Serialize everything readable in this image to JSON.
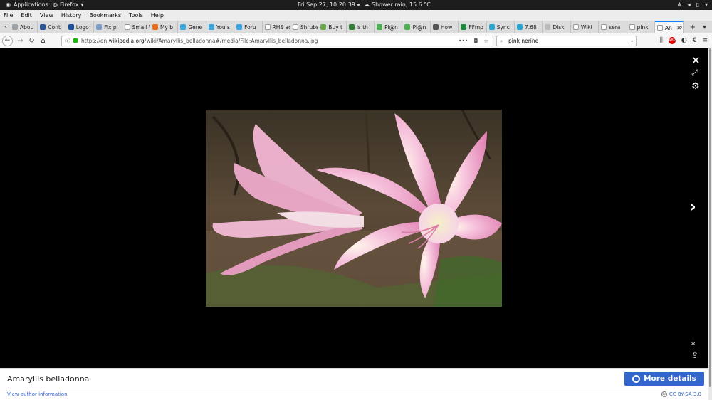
{
  "topbar": {
    "applications": "Applications",
    "firefox": "Firefox",
    "clock": "Fri Sep 27, 10:20:39",
    "weather": "Shower rain, 15.6 °C"
  },
  "menu": [
    "File",
    "Edit",
    "View",
    "History",
    "Bookmarks",
    "Tools",
    "Help"
  ],
  "tabs": [
    {
      "label": "Abou",
      "color": "#9aa0a6"
    },
    {
      "label": "Cont",
      "color": "#2b5797"
    },
    {
      "label": "Logo",
      "color": "#1f4e99"
    },
    {
      "label": "Fix p",
      "color": "#7a9cc6"
    },
    {
      "label": "Small W",
      "color": "#ffffff"
    },
    {
      "label": "My b",
      "color": "#e86a1a"
    },
    {
      "label": "Gene",
      "color": "#3aa6dd"
    },
    {
      "label": "You s",
      "color": "#3aa6dd"
    },
    {
      "label": "Foru",
      "color": "#3aa6dd"
    },
    {
      "label": "RHS adv",
      "color": "#ffffff"
    },
    {
      "label": "Shrubs",
      "color": "#ffffff"
    },
    {
      "label": "Buy t",
      "color": "#6aa84f"
    },
    {
      "label": "Is th",
      "color": "#2e7d32"
    },
    {
      "label": "Pl@n",
      "color": "#4caf50"
    },
    {
      "label": "Pl@n",
      "color": "#4caf50"
    },
    {
      "label": "How",
      "color": "#555555"
    },
    {
      "label": "FFmp",
      "color": "#1e8e3e"
    },
    {
      "label": "Sync",
      "color": "#26a6d1"
    },
    {
      "label": "7.68",
      "color": "#26a6d1"
    },
    {
      "label": "Disk",
      "color": "#bbbbbb"
    },
    {
      "label": "Wiki",
      "color": "#ffffff"
    },
    {
      "label": "sera",
      "color": "#ffffff"
    },
    {
      "label": "pink",
      "color": "#ffffff"
    },
    {
      "label": "An",
      "color": "#ffffff",
      "active": true
    }
  ],
  "nav": {
    "url_prefix": "https://en.",
    "url_domain": "wikipedia.org",
    "url_path": "/wiki/Amaryllis_belladonna#/media/File:Amaryllis_belladonna.jpg",
    "search_value": "pink nerine"
  },
  "media": {
    "title": "Amaryllis belladonna",
    "more_details": "More details",
    "author_link": "View author information",
    "license": "CC BY-SA 3.0"
  }
}
